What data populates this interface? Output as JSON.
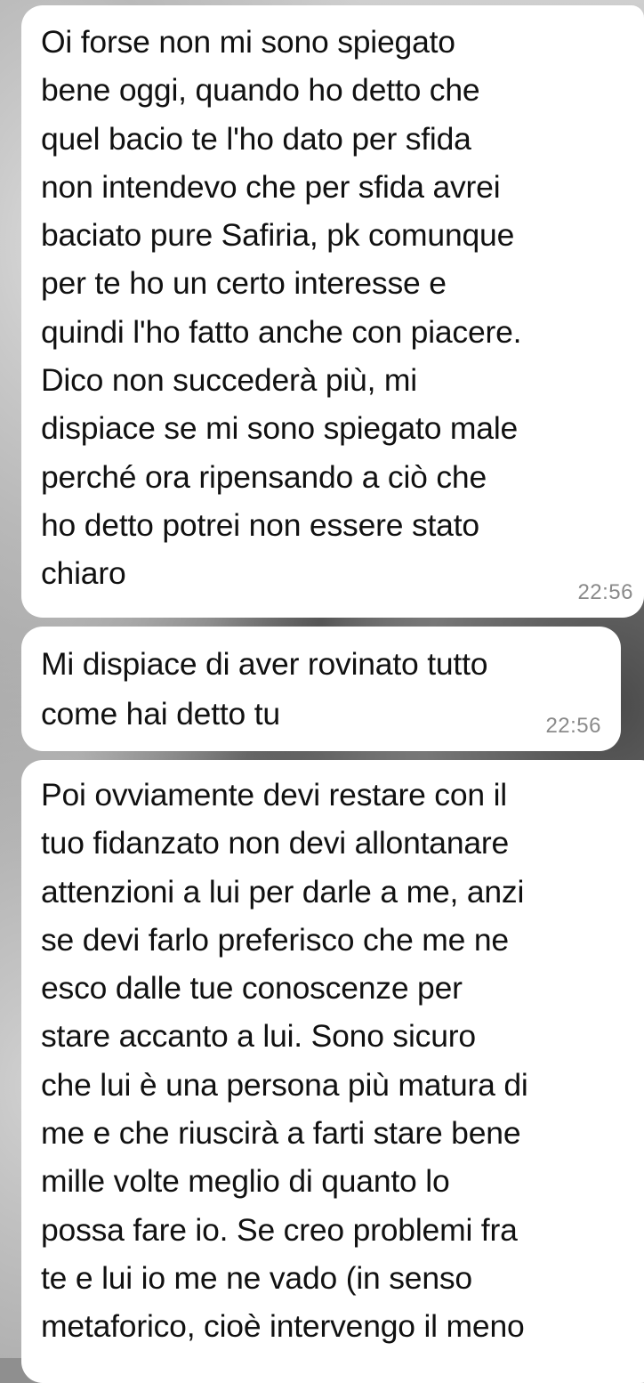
{
  "messages": [
    {
      "text": "Oi forse non mi sono spiegato\nbene oggi, quando ho detto che\nquel bacio te l'ho dato per sfida\nnon intendevo che per sfida avrei\nbaciato pure Safiria, pk comunque\nper te ho un certo interesse e\nquindi l'ho fatto anche con piacere.\nDico non succederà più, mi\ndispiace se mi sono spiegato male\nperché ora ripensando a ciò che\nho detto potrei non essere stato\nchiaro",
      "time": "22:56"
    },
    {
      "text": "Mi dispiace di aver rovinato tutto\ncome hai detto tu",
      "time": "22:56"
    },
    {
      "text": "Poi ovviamente devi restare con il\ntuo fidanzato non devi allontanare\nattenzioni a lui per darle a me, anzi\nse devi farlo preferisco che me ne\nesco dalle tue conoscenze per\nstare accanto a lui. Sono sicuro\nche lui è una persona più matura di\nme e che riuscirà a farti stare bene\nmille volte meglio di quanto lo\npossa fare io. Se creo problemi fra\nte e lui io me ne vado (in senso\nmetaforico, cioè intervengo il meno"
    }
  ],
  "colors": {
    "bubble": "#ffffff",
    "text": "#111111",
    "timestamp": "#8a8a8a"
  }
}
